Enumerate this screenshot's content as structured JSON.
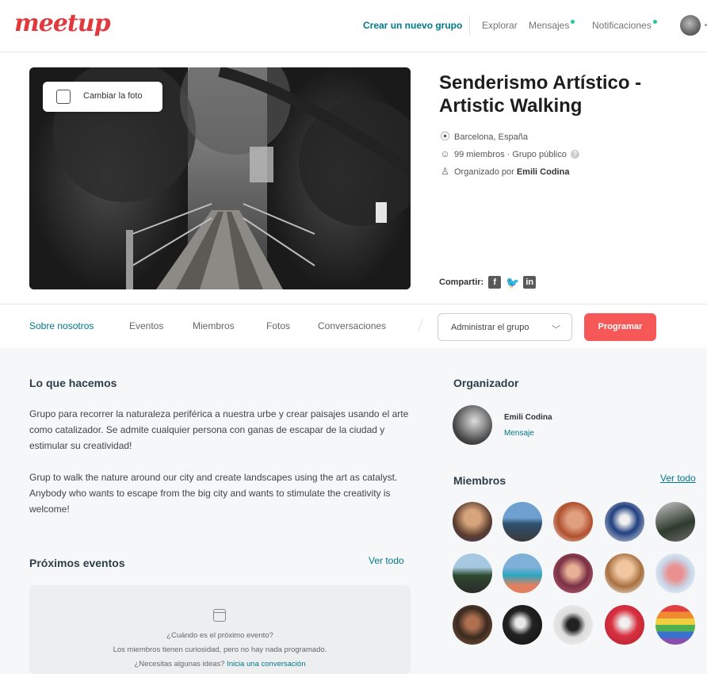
{
  "header": {
    "logo": "meetup",
    "nav": {
      "create_group": "Crear un nuevo grupo",
      "explore": "Explorar",
      "messages": "Mensajes",
      "notifications": "Notificaciones"
    }
  },
  "group": {
    "change_photo": "Cambiar la foto",
    "title": "Senderismo Artístico - Artistic Walking",
    "location": "Barcelona, España",
    "members_info": "99 miembros · Grupo público",
    "organized_by": "Organizado por",
    "organizer": "Emili Codina",
    "share_label": "Compartir:"
  },
  "tabs": [
    {
      "label": "Sobre nosotros",
      "active": true
    },
    {
      "label": "Eventos"
    },
    {
      "label": "Miembros"
    },
    {
      "label": "Fotos"
    },
    {
      "label": "Conversaciones"
    }
  ],
  "actions": {
    "admin": "Administrar el grupo",
    "schedule": "Programar"
  },
  "about": {
    "heading": "Lo que hacemos",
    "es": "Grupo para recorrer la naturaleza periférica a nuestra urbe y crear paisajes usando el arte como catalizador. Se admite cualquier persona con ganas de escapar de la ciudad y estimular su creatividad!",
    "en": "Grup to walk the nature around our city and create landscapes using the art as catalyst. Anybody who wants to escape from the big city and wants to stimulate the creativity is welcome!"
  },
  "events": {
    "heading": "Próximos eventos",
    "see_all": "Ver todo",
    "q": "¿Cuándo es el próximo evento?",
    "line2": "Los miembros tienen curiosidad, pero no hay nada programado.",
    "line3": "¿Necesitas algunas ideas?",
    "link": "Inicia una conversación"
  },
  "sidebar": {
    "org_heading": "Organizador",
    "org_name": "Emili Codina",
    "org_message": "Mensaje",
    "members_heading": "Miembros",
    "see_all": "Ver todo"
  },
  "colors": {
    "brand": "#e0393e",
    "teal": "#00798a",
    "primary_button": "#f65858"
  }
}
